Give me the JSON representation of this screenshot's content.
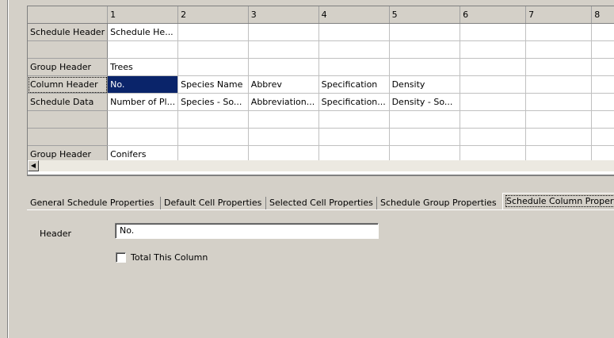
{
  "grid": {
    "columns": [
      "",
      "1",
      "2",
      "3",
      "4",
      "5",
      "6",
      "7",
      "8"
    ],
    "rows": [
      {
        "header": "Schedule Header",
        "cells": [
          "Schedule He...",
          "",
          "",
          "",
          "",
          "",
          "",
          ""
        ]
      },
      {
        "header": "",
        "cells": [
          "",
          "",
          "",
          "",
          "",
          "",
          "",
          ""
        ]
      },
      {
        "header": "Group Header",
        "cells": [
          "Trees",
          "",
          "",
          "",
          "",
          "",
          "",
          ""
        ]
      },
      {
        "header": "Column Header",
        "cells": [
          "No.",
          "Species Name",
          "Abbrev",
          "Specification",
          "Density",
          "",
          "",
          ""
        ]
      },
      {
        "header": "Schedule Data",
        "cells": [
          "Number of Pl...",
          "Species - So...",
          "Abbreviation...",
          "Specification...",
          "Density - So...",
          "",
          "",
          ""
        ]
      },
      {
        "header": "",
        "cells": [
          "",
          "",
          "",
          "",
          "",
          "",
          "",
          ""
        ]
      },
      {
        "header": "",
        "cells": [
          "",
          "",
          "",
          "",
          "",
          "",
          "",
          ""
        ]
      },
      {
        "header": "Group Header",
        "cells": [
          "Conifers",
          "",
          "",
          "",
          "",
          "",
          "",
          ""
        ]
      }
    ],
    "selected": {
      "row": 3,
      "col": 0
    }
  },
  "tabs": [
    "General Schedule Properties",
    "Default Cell Properties",
    "Selected Cell Properties",
    "Schedule Group Properties",
    "Schedule Column Propert"
  ],
  "active_tab": 4,
  "properties": {
    "header_label": "Header",
    "header_value": "No.",
    "total_checkbox_label": "Total This Column",
    "total_checked": false
  }
}
